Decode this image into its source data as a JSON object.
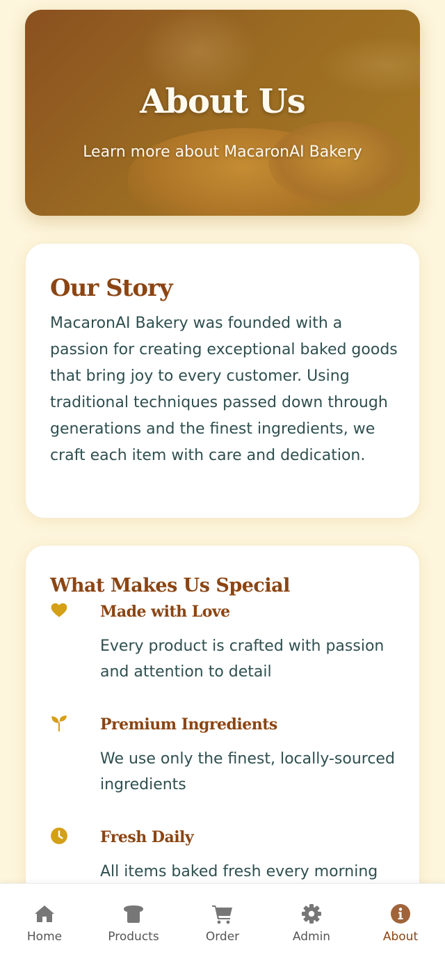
{
  "hero": {
    "title": "About Us",
    "subtitle": "Learn more about MacaronAI Bakery"
  },
  "story": {
    "title": "Our Story",
    "text": "MacaronAI Bakery was founded with a passion for creating exceptional baked goods that bring joy to every customer. Using traditional techniques passed down through generations and the finest ingredients, we craft each item with care and dedication."
  },
  "special": {
    "title": "What Makes Us Special",
    "features": [
      {
        "icon": "heart-icon",
        "name": "Made with Love",
        "description": "Every product is crafted with passion and attention to detail"
      },
      {
        "icon": "seedling-icon",
        "name": "Premium Ingredients",
        "description": "We use only the finest, locally-sourced ingredients"
      },
      {
        "icon": "clock-icon",
        "name": "Fresh Daily",
        "description": "All items baked fresh every morning"
      }
    ]
  },
  "nav": {
    "items": [
      {
        "label": "Home",
        "icon": "home-icon"
      },
      {
        "label": "Products",
        "icon": "bread-icon"
      },
      {
        "label": "Order",
        "icon": "cart-icon"
      },
      {
        "label": "Admin",
        "icon": "gear-icon"
      },
      {
        "label": "About",
        "icon": "info-icon"
      }
    ],
    "active": "About"
  },
  "colors": {
    "background": "#fdf5dc",
    "brand": "#8b4513",
    "accent": "#d4a017",
    "text": "#2f4f4f",
    "nav_icon": "#777777"
  }
}
